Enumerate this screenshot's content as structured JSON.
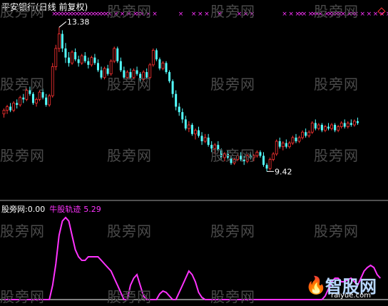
{
  "title": "平安银行(日线 前复权)",
  "watermark_text": "股旁网",
  "logo": {
    "name": "智股网",
    "url": "raiyue.com"
  },
  "colors": {
    "background": "#000000",
    "up": "#ff3333",
    "down": "#54ffff",
    "signal": "#ff33ff",
    "annotation": "#ffffff",
    "divider": "#a0a0a0"
  },
  "chart_data": [
    {
      "type": "candlestick",
      "title": "平安银行(日线 前复权)",
      "xlabel": "",
      "ylabel": "",
      "ylim": [
        8.8,
        13.7
      ],
      "grid": false,
      "annotations": [
        {
          "label": "13.38",
          "value": 13.38,
          "kind": "high"
        },
        {
          "label": "9.42",
          "value": 9.42,
          "kind": "low"
        }
      ],
      "markers": {
        "symbol": "×",
        "color": "#ff33ff",
        "indices": [
          15,
          16,
          17,
          18,
          19,
          20,
          21,
          22,
          23,
          24,
          25,
          26,
          27,
          28,
          29,
          30,
          31,
          32,
          34,
          36,
          38,
          40,
          41,
          42,
          44,
          46,
          54,
          58,
          60,
          62,
          66,
          72,
          74,
          76,
          86,
          88,
          90,
          91,
          92,
          94,
          95,
          96,
          97,
          99,
          100,
          101,
          102,
          103,
          104,
          106,
          107,
          108,
          110,
          112,
          114,
          116,
          118
        ]
      },
      "candles": [
        [
          11.0,
          11.15,
          10.9,
          11.1
        ],
        [
          11.1,
          11.25,
          11.0,
          11.2
        ],
        [
          11.2,
          11.3,
          11.05,
          11.1
        ],
        [
          11.1,
          11.35,
          11.05,
          11.3
        ],
        [
          11.3,
          11.4,
          11.15,
          11.25
        ],
        [
          11.25,
          11.5,
          11.2,
          11.45
        ],
        [
          11.45,
          11.55,
          11.3,
          11.4
        ],
        [
          11.4,
          11.7,
          11.35,
          11.65
        ],
        [
          11.65,
          11.75,
          11.5,
          11.55
        ],
        [
          11.55,
          11.6,
          11.25,
          11.3
        ],
        [
          11.3,
          11.45,
          11.2,
          11.4
        ],
        [
          11.4,
          11.65,
          11.35,
          11.6
        ],
        [
          11.6,
          11.7,
          11.4,
          11.45
        ],
        [
          11.45,
          11.55,
          11.2,
          11.25
        ],
        [
          11.25,
          11.55,
          11.2,
          11.5
        ],
        [
          11.5,
          12.4,
          11.45,
          12.3
        ],
        [
          12.3,
          12.9,
          12.2,
          12.8
        ],
        [
          12.8,
          13.38,
          12.7,
          13.2
        ],
        [
          13.2,
          13.3,
          12.7,
          12.8
        ],
        [
          12.8,
          12.95,
          12.4,
          12.55
        ],
        [
          12.55,
          12.7,
          12.3,
          12.4
        ],
        [
          12.4,
          12.75,
          12.35,
          12.7
        ],
        [
          12.7,
          12.8,
          12.45,
          12.5
        ],
        [
          12.5,
          12.6,
          12.3,
          12.4
        ],
        [
          12.4,
          12.65,
          12.35,
          12.6
        ],
        [
          12.6,
          12.7,
          12.4,
          12.45
        ],
        [
          12.45,
          12.55,
          12.25,
          12.35
        ],
        [
          12.35,
          12.6,
          12.3,
          12.55
        ],
        [
          12.55,
          12.65,
          12.35,
          12.4
        ],
        [
          12.4,
          12.5,
          12.15,
          12.2
        ],
        [
          12.2,
          12.3,
          11.95,
          12.0
        ],
        [
          12.0,
          12.3,
          11.95,
          12.25
        ],
        [
          12.25,
          12.35,
          12.05,
          12.1
        ],
        [
          12.1,
          12.5,
          12.05,
          12.45
        ],
        [
          12.45,
          12.85,
          12.4,
          12.8
        ],
        [
          12.8,
          12.85,
          12.4,
          12.45
        ],
        [
          12.45,
          12.55,
          12.15,
          12.2
        ],
        [
          12.2,
          12.3,
          11.95,
          12.0
        ],
        [
          12.0,
          12.2,
          11.95,
          12.15
        ],
        [
          12.15,
          12.25,
          11.95,
          12.0
        ],
        [
          12.0,
          12.25,
          11.95,
          12.2
        ],
        [
          12.2,
          12.3,
          12.05,
          12.1
        ],
        [
          12.1,
          12.15,
          11.9,
          11.95
        ],
        [
          11.95,
          12.2,
          11.9,
          12.15
        ],
        [
          12.15,
          12.25,
          11.95,
          12.0
        ],
        [
          12.0,
          12.4,
          11.95,
          12.35
        ],
        [
          12.35,
          12.8,
          12.3,
          12.75
        ],
        [
          12.75,
          12.8,
          12.45,
          12.5
        ],
        [
          12.5,
          12.55,
          12.2,
          12.25
        ],
        [
          12.25,
          12.45,
          12.2,
          12.4
        ],
        [
          12.4,
          12.45,
          12.1,
          12.15
        ],
        [
          12.15,
          12.2,
          11.85,
          11.9
        ],
        [
          11.9,
          11.95,
          11.45,
          11.55
        ],
        [
          11.55,
          11.65,
          11.1,
          11.2
        ],
        [
          11.2,
          11.3,
          10.95,
          11.05
        ],
        [
          11.05,
          11.15,
          10.75,
          10.85
        ],
        [
          10.85,
          10.95,
          10.55,
          10.6
        ],
        [
          10.6,
          10.8,
          10.5,
          10.7
        ],
        [
          10.7,
          10.75,
          10.4,
          10.45
        ],
        [
          10.45,
          10.6,
          10.3,
          10.55
        ],
        [
          10.55,
          10.65,
          10.35,
          10.4
        ],
        [
          10.4,
          10.5,
          10.15,
          10.25
        ],
        [
          10.25,
          10.45,
          10.2,
          10.35
        ],
        [
          10.35,
          10.45,
          10.1,
          10.15
        ],
        [
          10.15,
          10.25,
          9.95,
          10.05
        ],
        [
          10.05,
          10.2,
          9.9,
          10.15
        ],
        [
          10.15,
          10.25,
          9.95,
          10.0
        ],
        [
          10.0,
          10.05,
          9.75,
          9.8
        ],
        [
          9.8,
          9.95,
          9.7,
          9.9
        ],
        [
          9.9,
          10.0,
          9.75,
          9.8
        ],
        [
          9.8,
          9.85,
          9.6,
          9.65
        ],
        [
          9.65,
          9.8,
          9.6,
          9.75
        ],
        [
          9.75,
          9.9,
          9.7,
          9.85
        ],
        [
          9.85,
          9.95,
          9.7,
          9.75
        ],
        [
          9.75,
          9.85,
          9.6,
          9.7
        ],
        [
          9.7,
          9.9,
          9.65,
          9.85
        ],
        [
          9.85,
          9.95,
          9.75,
          9.8
        ],
        [
          9.8,
          9.9,
          9.7,
          9.85
        ],
        [
          9.85,
          10.0,
          9.8,
          9.95
        ],
        [
          9.95,
          10.0,
          9.8,
          9.85
        ],
        [
          9.85,
          9.95,
          9.55,
          9.6
        ],
        [
          9.6,
          9.65,
          9.42,
          9.5
        ],
        [
          9.5,
          9.8,
          9.45,
          9.75
        ],
        [
          9.75,
          9.95,
          9.7,
          9.9
        ],
        [
          9.9,
          10.3,
          9.85,
          10.25
        ],
        [
          10.25,
          10.35,
          10.05,
          10.1
        ],
        [
          10.1,
          10.25,
          10.0,
          10.2
        ],
        [
          10.2,
          10.3,
          10.05,
          10.1
        ],
        [
          10.1,
          10.25,
          10.05,
          10.2
        ],
        [
          10.2,
          10.4,
          10.15,
          10.35
        ],
        [
          10.35,
          10.45,
          10.2,
          10.25
        ],
        [
          10.25,
          10.4,
          10.2,
          10.35
        ],
        [
          10.35,
          10.55,
          10.3,
          10.5
        ],
        [
          10.5,
          10.6,
          10.35,
          10.4
        ],
        [
          10.4,
          10.55,
          10.35,
          10.5
        ],
        [
          10.5,
          10.8,
          10.45,
          10.75
        ],
        [
          10.75,
          10.85,
          10.55,
          10.6
        ],
        [
          10.6,
          10.75,
          10.55,
          10.7
        ],
        [
          10.7,
          10.75,
          10.5,
          10.55
        ],
        [
          10.55,
          10.7,
          10.5,
          10.65
        ],
        [
          10.65,
          10.75,
          10.55,
          10.6
        ],
        [
          10.6,
          10.75,
          10.55,
          10.7
        ],
        [
          10.7,
          10.75,
          10.5,
          10.55
        ],
        [
          10.55,
          10.7,
          10.5,
          10.65
        ],
        [
          10.65,
          10.8,
          10.6,
          10.75
        ],
        [
          10.75,
          10.85,
          10.6,
          10.65
        ],
        [
          10.65,
          10.8,
          10.6,
          10.75
        ],
        [
          10.75,
          10.85,
          10.65,
          10.7
        ],
        [
          10.7,
          10.85,
          10.65,
          10.8
        ],
        [
          10.8,
          10.9,
          10.7,
          10.75
        ]
      ]
    },
    {
      "type": "line",
      "title": "股旁网",
      "header_value": "0.00",
      "series_name": "牛股轨迹",
      "series_value": "5.29",
      "ylim": [
        0,
        12
      ],
      "values": [
        0,
        0,
        0,
        0,
        0,
        0,
        0,
        0,
        0,
        0,
        0,
        0,
        0,
        0,
        0,
        2,
        5,
        9,
        11,
        11.5,
        11,
        9,
        7,
        6,
        5.5,
        5.5,
        6,
        6,
        6,
        6,
        5.5,
        5,
        4.5,
        4,
        3,
        2,
        1,
        0,
        0,
        2,
        3,
        3.5,
        2,
        0.5,
        0,
        0,
        0,
        0,
        0.8,
        1.2,
        1,
        0.5,
        0,
        0,
        1,
        2,
        3,
        4,
        3.5,
        2.5,
        1,
        0.3,
        0,
        0,
        0,
        0,
        0,
        0,
        0,
        0,
        0,
        0,
        0,
        0,
        0,
        0,
        0,
        0,
        0,
        0,
        0,
        0,
        0,
        0,
        0,
        0,
        0,
        0,
        0,
        0,
        0,
        0,
        0,
        0,
        0,
        0,
        0,
        0,
        0,
        0.5,
        1.5,
        2.5,
        3,
        3,
        2.5,
        2.5,
        2.8,
        3,
        2.5,
        2,
        3,
        4,
        4.5,
        4.8,
        4.5,
        3.5,
        3
      ]
    }
  ]
}
